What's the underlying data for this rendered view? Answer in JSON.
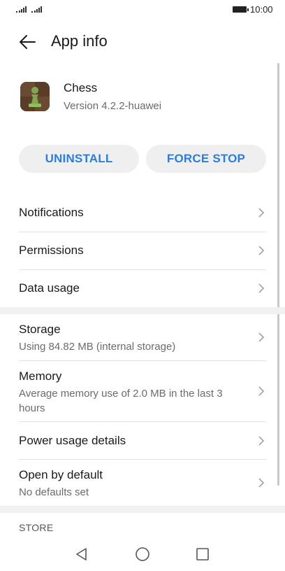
{
  "status_bar": {
    "time": "10:00",
    "signal_icon": "signal-icon",
    "battery_icon": "battery-icon"
  },
  "header": {
    "title": "App info",
    "back_icon": "arrow-left-icon"
  },
  "app": {
    "name": "Chess",
    "version": "Version 4.2.2-huawei",
    "icon": "chess-pawn-icon"
  },
  "actions": {
    "uninstall": "UNINSTALL",
    "force_stop": "FORCE STOP",
    "accent": "#2a7de1"
  },
  "items": [
    {
      "title": "Notifications"
    },
    {
      "title": "Permissions"
    },
    {
      "title": "Data usage"
    },
    {
      "title": "Storage",
      "subtitle": "Using 84.82 MB (internal storage)"
    },
    {
      "title": "Memory",
      "subtitle": "Average memory use of 2.0 MB in the last 3 hours"
    },
    {
      "title": "Power usage details"
    },
    {
      "title": "Open by default",
      "subtitle": "No defaults set"
    }
  ],
  "section": {
    "store": "STORE"
  },
  "nav": {
    "back": "triangle-back-icon",
    "home": "circle-home-icon",
    "recents": "square-recents-icon"
  }
}
